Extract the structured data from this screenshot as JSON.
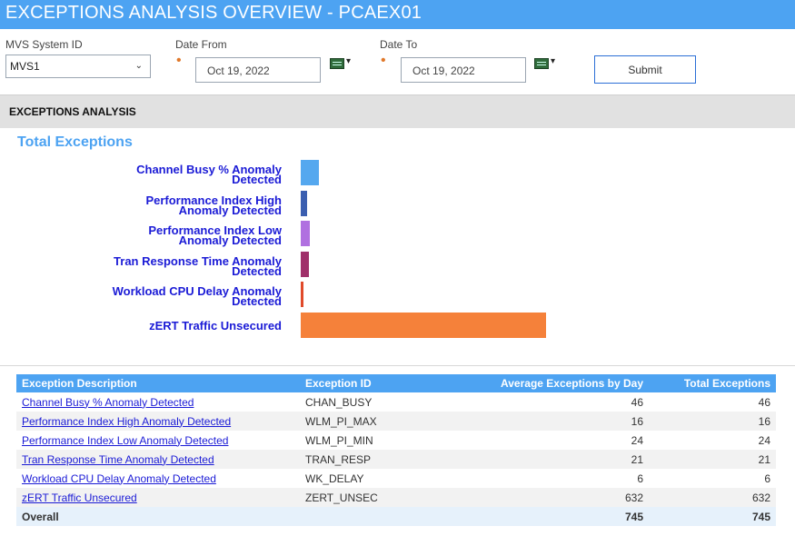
{
  "header": {
    "title": "EXCEPTIONS ANALYSIS OVERVIEW - PCAEX01"
  },
  "filters": {
    "system_label": "MVS System ID",
    "system_value": "MVS1",
    "date_from_label": "Date From",
    "date_from_value": "Oct 19, 2022",
    "date_to_label": "Date To",
    "date_to_value": "Oct 19, 2022",
    "required_marker": "•",
    "submit_label": "Submit"
  },
  "section": {
    "title": "EXCEPTIONS ANALYSIS"
  },
  "chart_data": {
    "type": "bar",
    "orientation": "horizontal",
    "title": "Total Exceptions",
    "categories": [
      "Channel Busy % Anomaly Detected",
      "Performance Index High Anomaly Detected",
      "Performance Index Low Anomaly Detected",
      "Tran Response Time Anomaly Detected",
      "Workload CPU Delay Anomaly Detected",
      "zERT Traffic Unsecured"
    ],
    "category_lines": [
      [
        "Channel Busy % Anomaly",
        "Detected"
      ],
      [
        "Performance Index High",
        "Anomaly Detected"
      ],
      [
        "Performance Index Low",
        "Anomaly Detected"
      ],
      [
        "Tran Response Time Anomaly",
        "Detected"
      ],
      [
        "Workload CPU Delay Anomaly",
        "Detected"
      ],
      [
        "zERT Traffic Unsecured"
      ]
    ],
    "values": [
      46,
      16,
      24,
      21,
      6,
      632
    ],
    "colors": [
      "#55a8ef",
      "#3b5fb0",
      "#b070e0",
      "#a0306a",
      "#e04a2a",
      "#f5813a"
    ],
    "xlim": [
      0,
      632
    ],
    "grid": false
  },
  "table": {
    "columns": [
      "Exception Description",
      "Exception ID",
      "Average Exceptions by Day",
      "Total Exceptions"
    ],
    "rows": [
      [
        "Channel Busy % Anomaly Detected",
        "CHAN_BUSY",
        "46",
        "46"
      ],
      [
        "Performance Index High Anomaly Detected",
        "WLM_PI_MAX",
        "16",
        "16"
      ],
      [
        "Performance Index Low Anomaly Detected",
        "WLM_PI_MIN",
        "24",
        "24"
      ],
      [
        "Tran Response Time Anomaly Detected",
        "TRAN_RESP",
        "21",
        "21"
      ],
      [
        "Workload CPU Delay Anomaly Detected",
        "WK_DELAY",
        "6",
        "6"
      ],
      [
        "zERT Traffic Unsecured",
        "ZERT_UNSEC",
        "632",
        "632"
      ]
    ],
    "overall": [
      "Overall",
      "",
      "745",
      "745"
    ]
  },
  "icons": {
    "calendar": "calendar-icon",
    "dropdown": "chevron-down-icon"
  }
}
